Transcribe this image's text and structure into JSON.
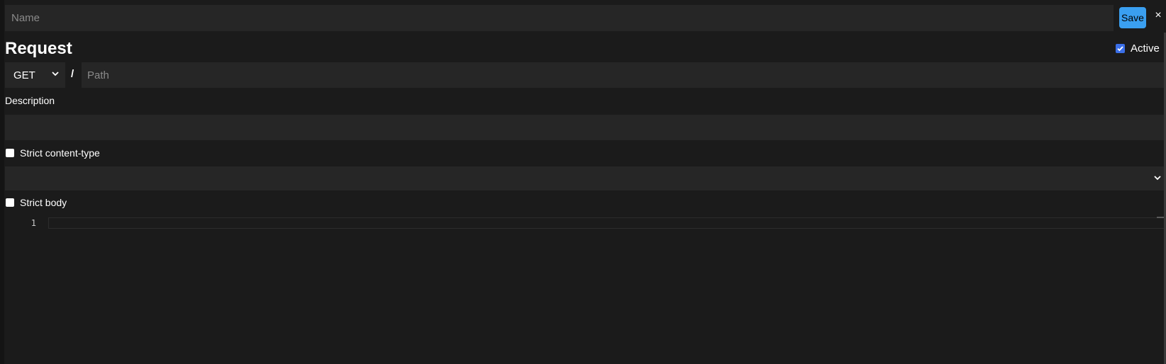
{
  "header": {
    "name_placeholder": "Name",
    "save_label": "Save",
    "close_label": "×"
  },
  "request": {
    "title": "Request",
    "active_label": "Active",
    "active_checked": true,
    "method": "GET",
    "method_icon": "chevron-down-icon",
    "slash": "/",
    "path_placeholder": "Path"
  },
  "description": {
    "label": "Description",
    "value": ""
  },
  "strict_content_type": {
    "label": "Strict content-type",
    "checked": false,
    "selected_value": ""
  },
  "strict_body": {
    "label": "Strict body",
    "checked": false
  },
  "editor": {
    "line_numbers": [
      "1"
    ]
  },
  "colors": {
    "accent": "#3a9ff0",
    "background": "#1b1b1b",
    "field": "#262626",
    "checkbox_checked": "#3b6fe8"
  }
}
